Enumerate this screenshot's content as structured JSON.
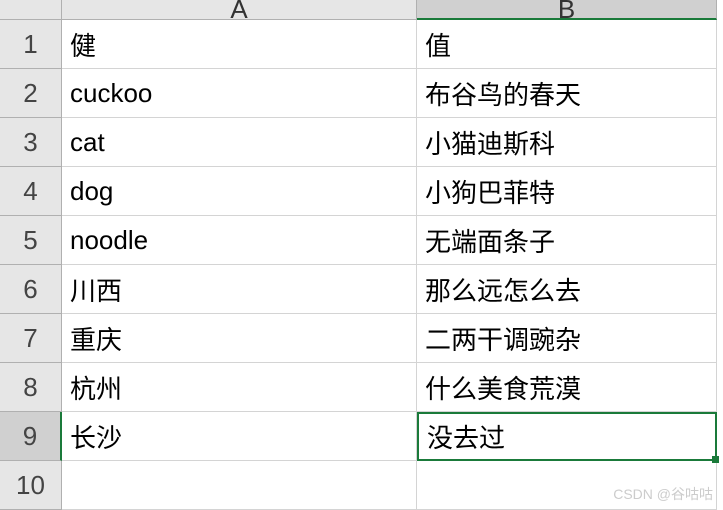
{
  "columns": [
    "A",
    "B"
  ],
  "row_count": 10,
  "active_cell": {
    "row": 9,
    "col": "B"
  },
  "chart_data": {
    "type": "table",
    "columns": [
      "A",
      "B"
    ],
    "rows": [
      {
        "A": "健",
        "B": "值"
      },
      {
        "A": "cuckoo",
        "B": "布谷鸟的春天"
      },
      {
        "A": "cat",
        "B": "小猫迪斯科"
      },
      {
        "A": "dog",
        "B": "小狗巴菲特"
      },
      {
        "A": "noodle",
        "B": "无端面条子"
      },
      {
        "A": "川西",
        "B": "那么远怎么去"
      },
      {
        "A": "重庆",
        "B": "二两干调豌杂"
      },
      {
        "A": "杭州",
        "B": "什么美食荒漠"
      },
      {
        "A": "长沙",
        "B": "没去过"
      },
      {
        "A": "",
        "B": ""
      }
    ]
  },
  "watermark": "CSDN @谷咕咕"
}
